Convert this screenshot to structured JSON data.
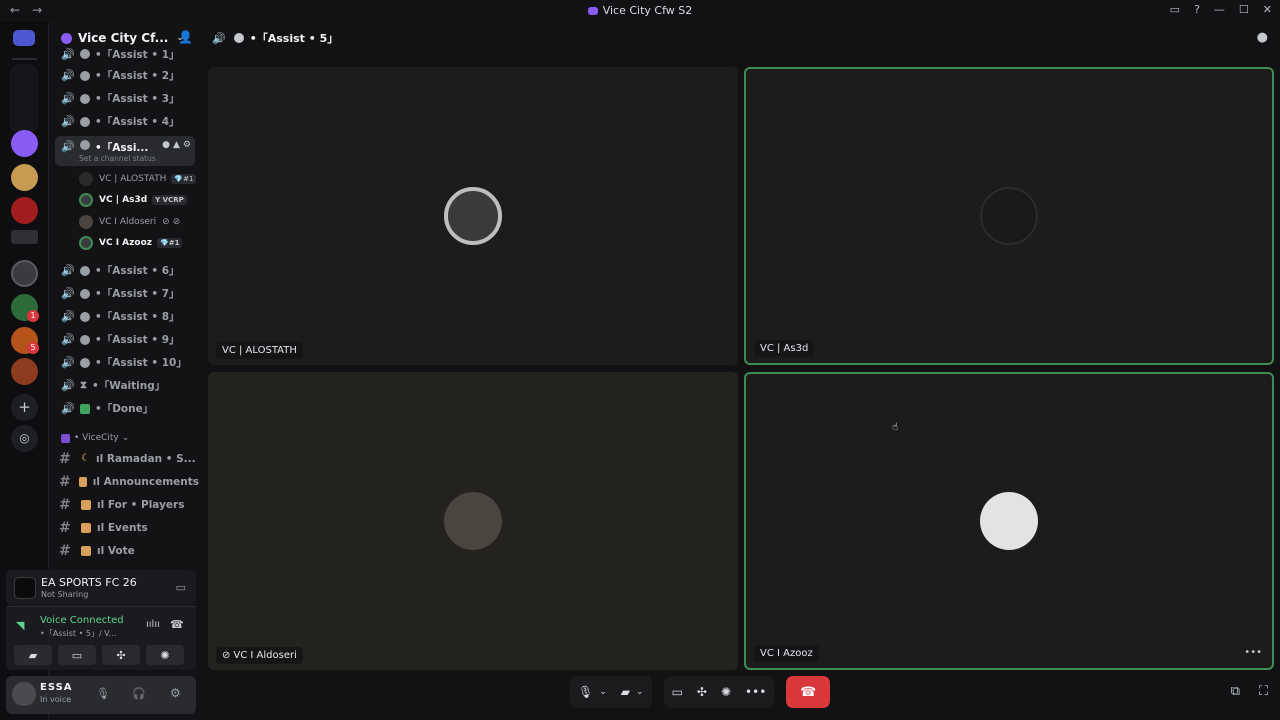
{
  "window": {
    "title": "Vice City Cfw S2",
    "controls": [
      "▭",
      "?",
      "—",
      "☐",
      "✕"
    ]
  },
  "server": {
    "name": "Vice City Cf...",
    "voice_channels_top": [
      {
        "label": "•「Assist • 1」"
      },
      {
        "label": "•「Assist • 2」"
      },
      {
        "label": "•「Assist • 3」"
      },
      {
        "label": "•「Assist • 4」"
      }
    ],
    "active_channel": {
      "label": "•「Assi...",
      "status_placeholder": "Set a channel status"
    },
    "members": [
      {
        "name": "VC | ALOSTATH",
        "tag": "💎#1"
      },
      {
        "name": "VC | As3d",
        "tag": "Y VCRP"
      },
      {
        "name": "VC I Aldoseri",
        "tag": ""
      },
      {
        "name": "VC I Azooz",
        "tag": "💎#1"
      }
    ],
    "voice_channels_bottom": [
      {
        "label": "•「Assist • 6」"
      },
      {
        "label": "•「Assist • 7」"
      },
      {
        "label": "•「Assist • 8」"
      },
      {
        "label": "•「Assist • 9」"
      },
      {
        "label": "•「Assist • 10」"
      },
      {
        "label": "•「Waiting」"
      },
      {
        "label": "•「Done」"
      }
    ],
    "category": "• ViceCity",
    "text_channels": [
      {
        "label": "ıl Ramadan • S..."
      },
      {
        "label": "ıl Announcements"
      },
      {
        "label": "ıl For • Players"
      },
      {
        "label": "ıl Events"
      },
      {
        "label": "ıl Vote"
      }
    ]
  },
  "activity": {
    "game": "EA SPORTS FC 26",
    "state": "Not Sharing"
  },
  "voice": {
    "status": "Voice Connected",
    "channel": "•「Assist • 5」/ V..."
  },
  "user": {
    "name": "ESSA",
    "status": "In voice"
  },
  "call": {
    "channel": "•「Assist • 5」",
    "tiles": [
      {
        "name": "VC | ALOSTATH",
        "speaking": false
      },
      {
        "name": "VC | As3d",
        "speaking": true
      },
      {
        "name": "VC I Aldoseri",
        "speaking": false
      },
      {
        "name": "VC I Azooz",
        "speaking": true
      }
    ]
  },
  "rail_badges": [
    "1",
    "5"
  ],
  "colors": {
    "accent": "#8a5cf6",
    "speaking": "#3f8c55",
    "voice_connected": "#5bd38a",
    "hangup": "#da373c"
  }
}
